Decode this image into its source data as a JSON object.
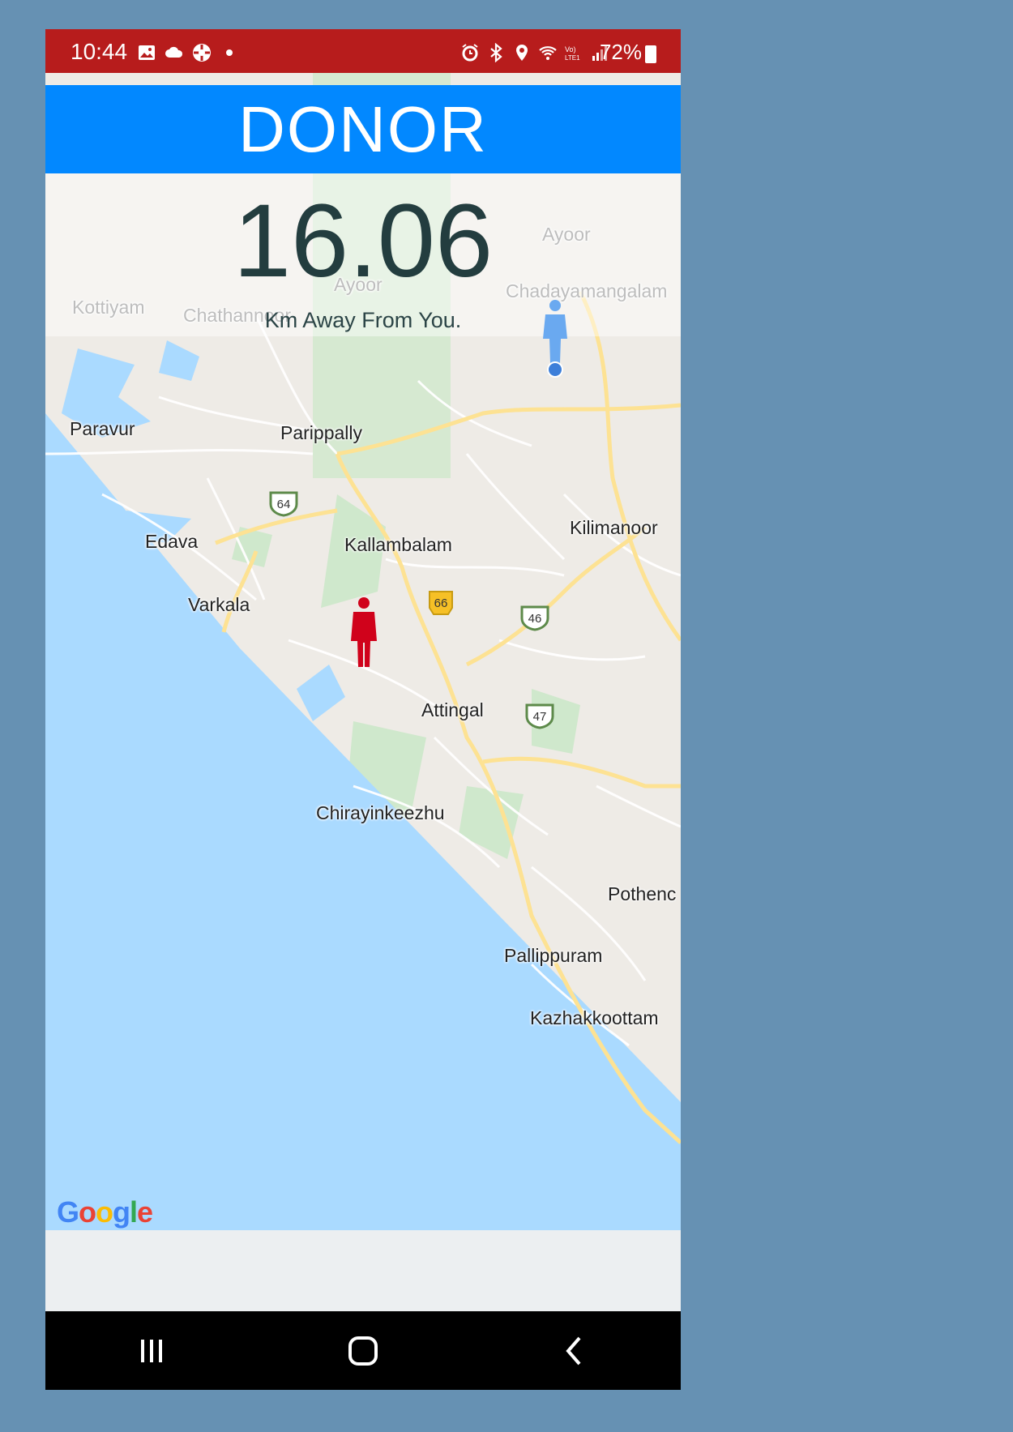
{
  "status_bar": {
    "time": "10:44",
    "battery": "72%",
    "left_icons": [
      "image-icon",
      "cloud-icon",
      "app-icon",
      "dot-icon"
    ],
    "right_icons": [
      "alarm-icon",
      "bluetooth-icon",
      "location-icon",
      "wifi-icon",
      "volte-icon",
      "signal-icon",
      "battery-icon"
    ]
  },
  "header": {
    "title": "DONOR"
  },
  "distance": {
    "value": "16.06",
    "caption": "Km Away From You."
  },
  "map": {
    "places": [
      {
        "name": "Ayoor",
        "faded": true
      },
      {
        "name": "Chadayamangalam",
        "faded": true
      },
      {
        "name": "Kottiyam",
        "faded": true
      },
      {
        "name": "Chathannoor",
        "faded": true
      },
      {
        "name": "Ayoor",
        "faded": true
      },
      {
        "name": "Paravur",
        "faded": false
      },
      {
        "name": "Parippally",
        "faded": false
      },
      {
        "name": "Edava",
        "faded": false
      },
      {
        "name": "Kallambalam",
        "faded": false
      },
      {
        "name": "Kilimanoor",
        "faded": false
      },
      {
        "name": "Varkala",
        "faded": false
      },
      {
        "name": "Attingal",
        "faded": false
      },
      {
        "name": "Chirayinkeezhu",
        "faded": false
      },
      {
        "name": "Pothenc",
        "faded": false
      },
      {
        "name": "Pallippuram",
        "faded": false
      },
      {
        "name": "Kazhakkoottam",
        "faded": false
      }
    ],
    "road_shields": [
      "64",
      "66",
      "46",
      "47"
    ],
    "attribution": "Google"
  },
  "markers": {
    "user_color": "#6aa9f0",
    "donor_color": "#d0021b"
  },
  "nav_bar": {
    "buttons": [
      "recents-button",
      "home-button",
      "back-button"
    ]
  },
  "colors": {
    "status_bar": "#b71c1c",
    "header": "#0288ff",
    "water": "#aadaff",
    "background": "#6691b3"
  }
}
